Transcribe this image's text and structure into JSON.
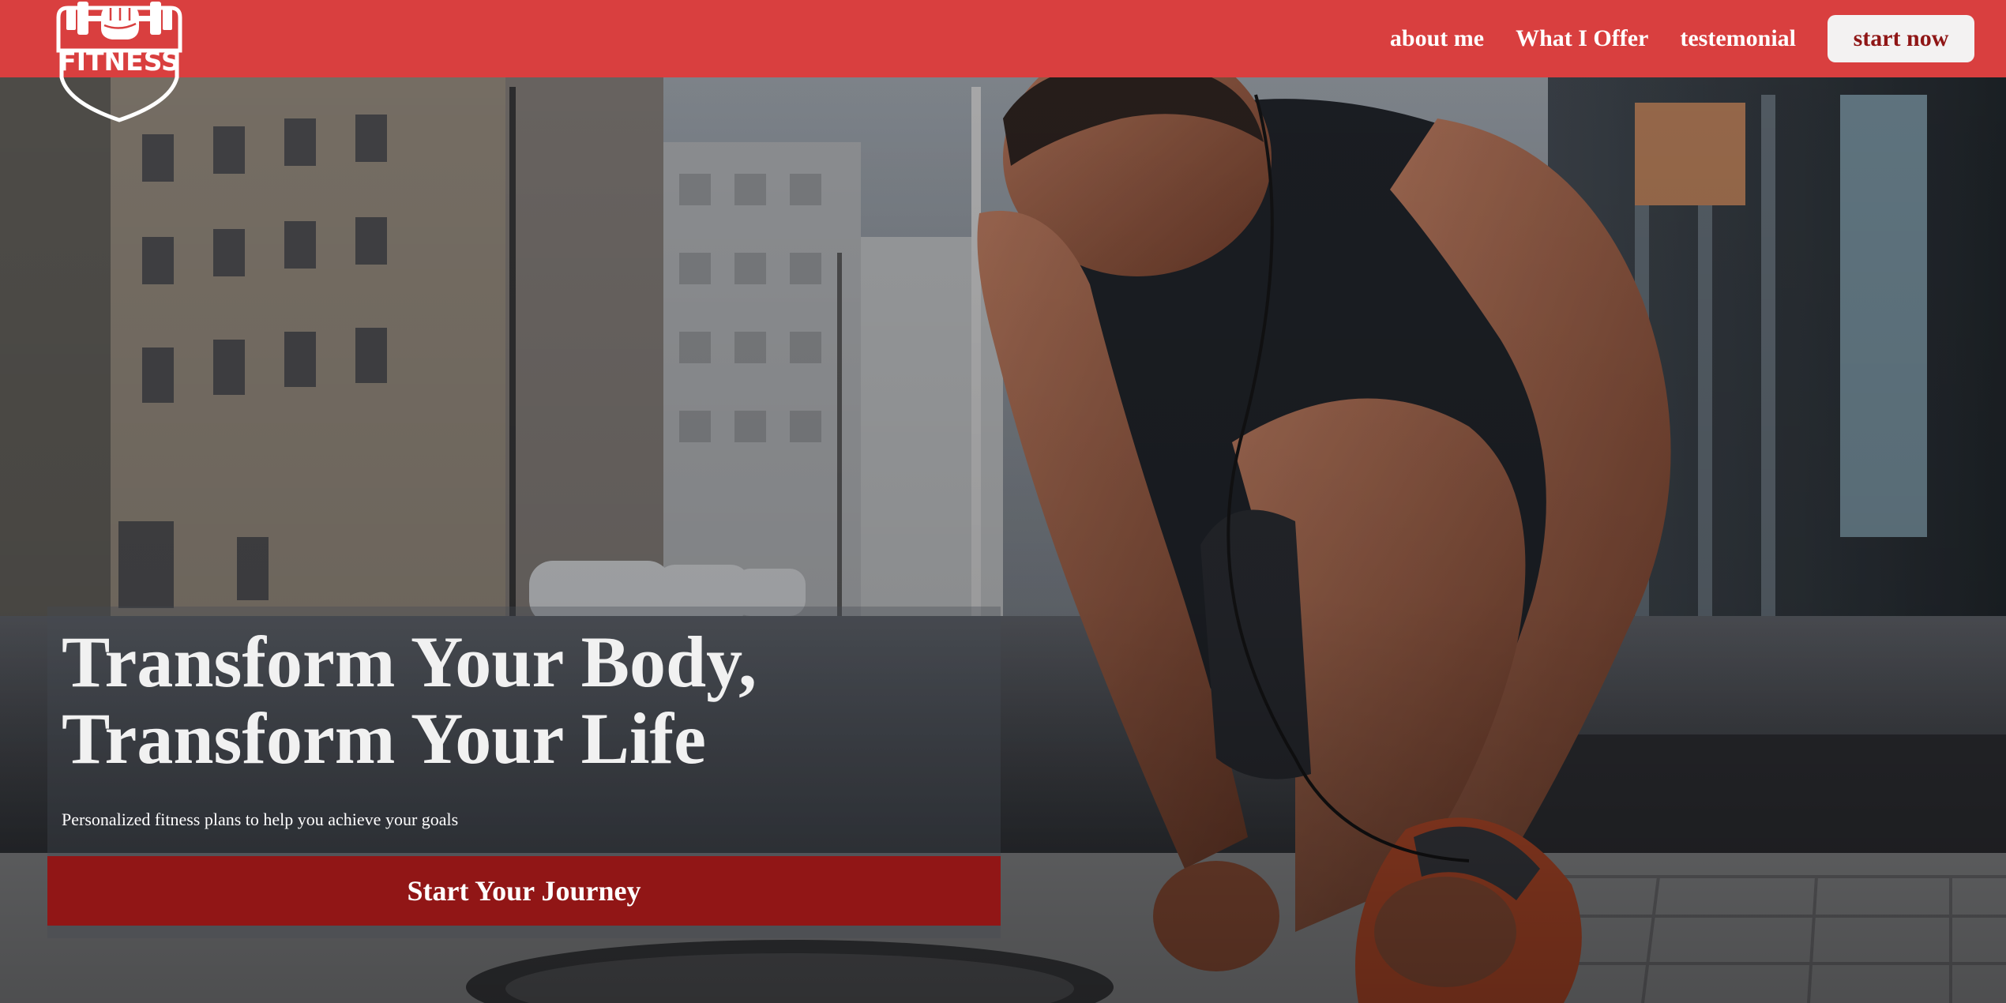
{
  "brand": {
    "logo_text": "FITNESS",
    "logo_icon": "fist-dumbbell-shield-icon"
  },
  "nav": {
    "links": [
      {
        "label": "about me"
      },
      {
        "label": "What I Offer"
      },
      {
        "label": "testemonial"
      }
    ],
    "cta_label": "start now"
  },
  "hero": {
    "title_line1": "Transform Your Body,",
    "title_line2": "Transform Your Life",
    "subtitle": "Personalized fitness plans to help you achieve your goals",
    "cta_label": "Start Your Journey",
    "background_image": "athlete-tying-shoe-on-city-street"
  },
  "colors": {
    "nav_bg": "#d93f3f",
    "cta_bg": "#911616",
    "nav_cta_text": "#8f1616",
    "nav_cta_bg": "#f3f2f2",
    "hero_text": "#f1f1f1"
  }
}
